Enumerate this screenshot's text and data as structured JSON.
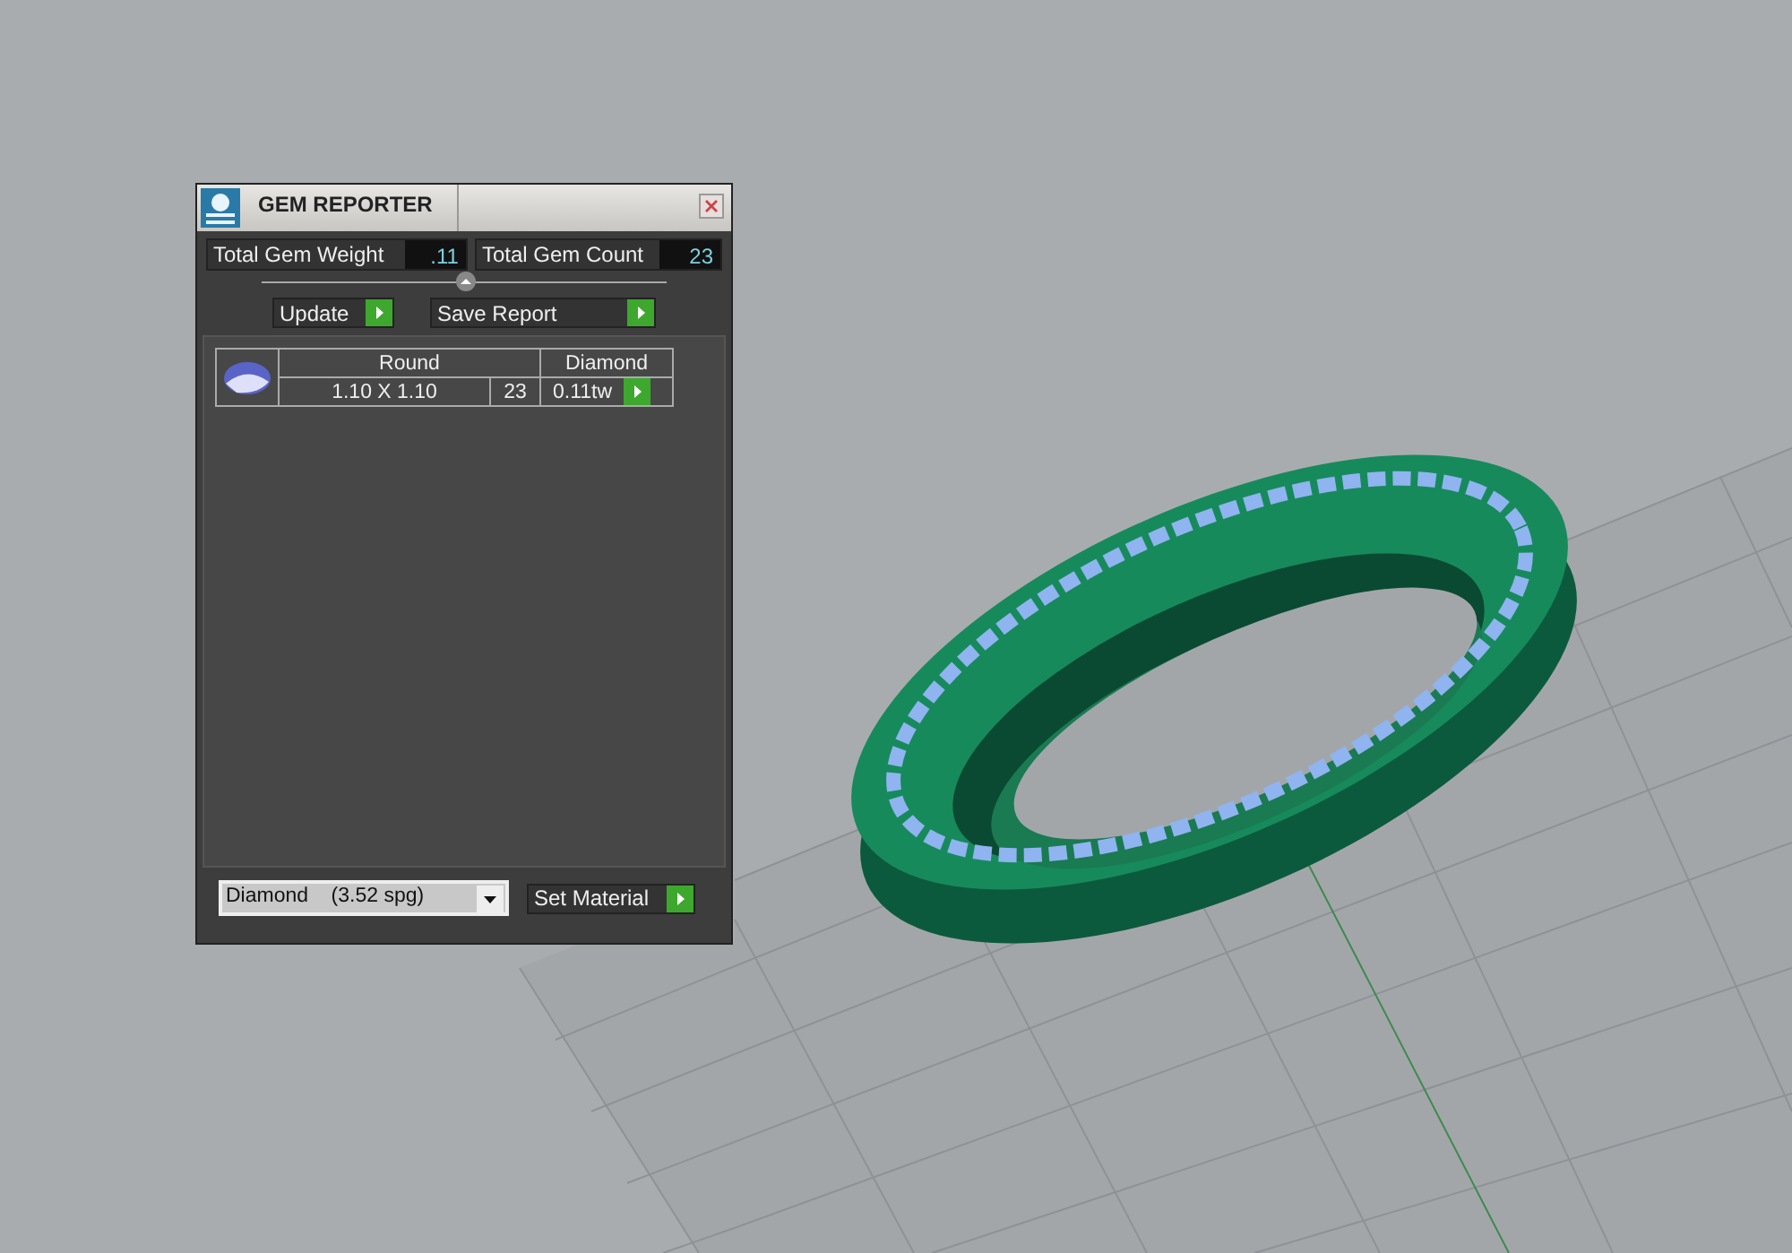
{
  "panel": {
    "title": "GEM REPORTER",
    "totals": [
      {
        "label": "Total Gem Weight",
        "value": ".11"
      },
      {
        "label": "Total Gem Count",
        "value": "23"
      }
    ],
    "buttons": [
      "Update",
      "Save Report"
    ],
    "gems": [
      {
        "shape": "Round",
        "material": "Diamond",
        "size": "1.10 X 1.10",
        "count": "23",
        "weight": "0.11tw"
      }
    ],
    "material_select": {
      "value": "Diamond    (3.52 spg)"
    },
    "set_button": "Set Material"
  }
}
